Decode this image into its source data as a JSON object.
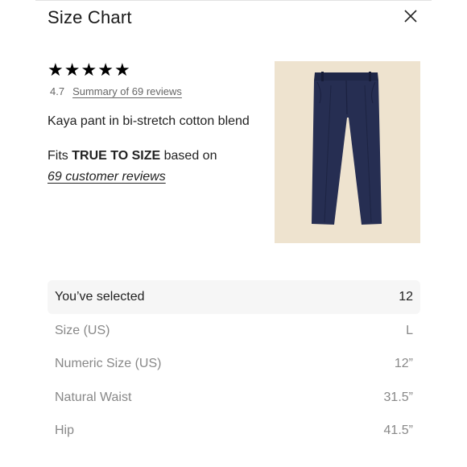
{
  "header": {
    "title": "Size Chart"
  },
  "product": {
    "stars": [
      "★",
      "★",
      "★",
      "★",
      "★"
    ],
    "rating": "4.7",
    "reviews_link": "Summary of 69 reviews",
    "description": "Kaya pant in bi-stretch cotton blend",
    "fit_prefix": "Fits",
    "fit_value": "TRUE TO SIZE",
    "fit_suffix": "based on",
    "fit_link": "69 customer reviews",
    "image_colors": {
      "background": "#eee3cf",
      "pant": "#262e52"
    }
  },
  "size_table": {
    "rows": [
      {
        "label": "You’ve selected",
        "value": "12"
      },
      {
        "label": "Size (US)",
        "value": "L"
      },
      {
        "label": "Numeric Size (US)",
        "value": "12”"
      },
      {
        "label": "Natural Waist",
        "value": "31.5”"
      },
      {
        "label": "Hip",
        "value": "41.5”"
      }
    ]
  }
}
